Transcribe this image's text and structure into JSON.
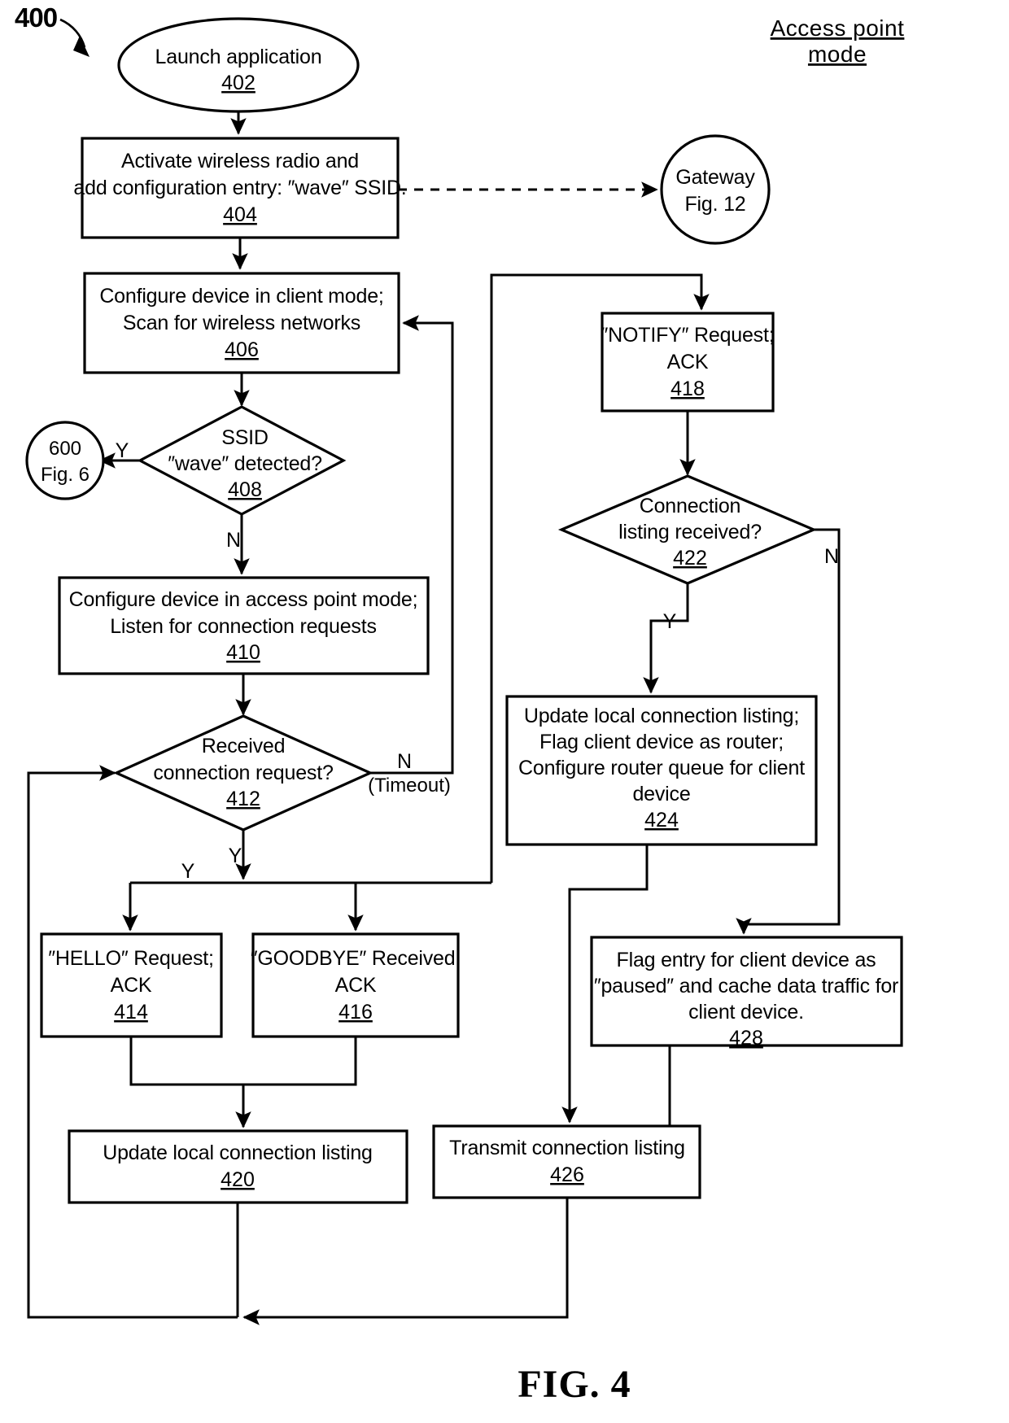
{
  "figure": {
    "number_label": "400",
    "caption": "FIG. 4",
    "mode_title_line1": "Access point",
    "mode_title_line2": "mode"
  },
  "nodes": {
    "n402": {
      "ref": "402",
      "lines": [
        "Launch application"
      ],
      "shape": "ellipse"
    },
    "n404": {
      "ref": "404",
      "lines": [
        "Activate wireless radio and",
        "add configuration entry: ″wave″ SSID."
      ],
      "shape": "process"
    },
    "n406": {
      "ref": "406",
      "lines": [
        "Configure device in client mode;",
        "Scan for wireless networks"
      ],
      "shape": "process"
    },
    "n408": {
      "ref": "408",
      "lines": [
        "SSID",
        "″wave″ detected?"
      ],
      "shape": "decision"
    },
    "n410": {
      "ref": "410",
      "lines": [
        "Configure device in access point mode;",
        "Listen for connection requests"
      ],
      "shape": "process"
    },
    "n412": {
      "ref": "412",
      "lines": [
        "Received",
        "connection request?"
      ],
      "shape": "decision"
    },
    "n414": {
      "ref": "414",
      "lines": [
        "″HELLO″ Request;",
        "ACK"
      ],
      "shape": "process"
    },
    "n416": {
      "ref": "416",
      "lines": [
        "″GOODBYE″ Received;",
        "ACK"
      ],
      "shape": "process"
    },
    "n418": {
      "ref": "418",
      "lines": [
        "″NOTIFY″ Request;",
        "ACK"
      ],
      "shape": "process"
    },
    "n420": {
      "ref": "420",
      "lines": [
        "Update local connection listing"
      ],
      "shape": "process"
    },
    "n422": {
      "ref": "422",
      "lines": [
        "Connection",
        "listing received?"
      ],
      "shape": "decision"
    },
    "n424": {
      "ref": "424",
      "lines": [
        "Update local connection listing;",
        "Flag client device as router;",
        "Configure router queue for client",
        "device"
      ],
      "shape": "process"
    },
    "n426": {
      "ref": "426",
      "lines": [
        "Transmit connection listing"
      ],
      "shape": "process"
    },
    "n428": {
      "ref": "428",
      "lines": [
        "Flag entry for client device as",
        "″paused″ and cache data traffic for",
        "client device."
      ],
      "shape": "process"
    },
    "gateway": {
      "lines": [
        "Gateway",
        "Fig. 12"
      ],
      "shape": "connector-circle"
    },
    "conn600": {
      "lines": [
        "600",
        "Fig. 6"
      ],
      "shape": "connector-circle"
    }
  },
  "edge_labels": {
    "e408_yes": "Y",
    "e408_no": "N",
    "e412_no": "N",
    "e412_no_sub": "(Timeout)",
    "e412_yes": "Y",
    "e412_bus_yes": "Y",
    "e422_yes": "Y",
    "e422_no": "N"
  },
  "colors": {
    "ink": "#000000",
    "paper": "#ffffff"
  }
}
